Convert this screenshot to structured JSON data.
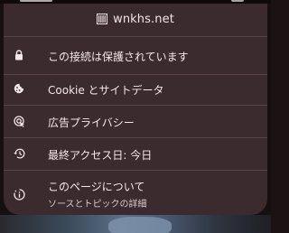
{
  "site": {
    "favicon_icon": "site-favicon-icon",
    "name": "wnkhs.net"
  },
  "menu": {
    "items": [
      {
        "icon": "lock-icon",
        "label": "この接続は保護されています"
      },
      {
        "icon": "cookie-icon",
        "label": "Cookie とサイトデータ"
      },
      {
        "icon": "ad-privacy-icon",
        "label": "広告プライバシー"
      },
      {
        "icon": "history-icon",
        "label": "最終アクセス日: 今日"
      },
      {
        "icon": "info-icon",
        "label": "このページについて",
        "sublabel": "ソースとトピックの詳細"
      }
    ]
  },
  "colors": {
    "sheet_background": "#3b2a2e",
    "text_primary": "#f3e8e9",
    "text_secondary": "#d8c9cb",
    "divider": "#5b4347"
  }
}
